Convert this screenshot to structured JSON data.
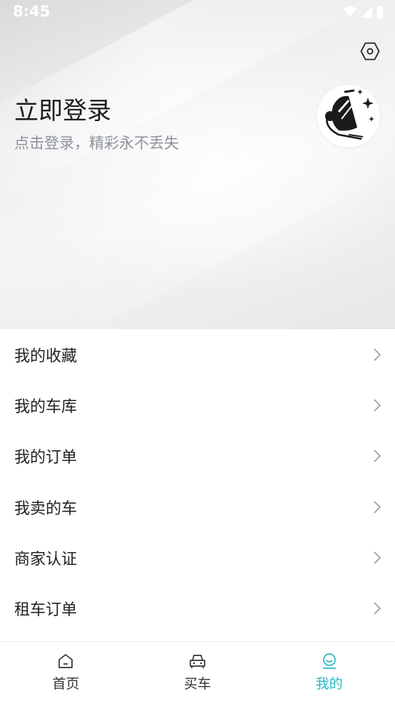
{
  "status_bar": {
    "time": "8:45"
  },
  "colors": {
    "accent": "#2bb8c4",
    "text": "#222222",
    "subtext": "#8e9299"
  },
  "header": {
    "settings_icon": "settings-hexagon-icon",
    "login_title": "立即登录",
    "login_subtitle": "点击登录，精彩永不丢失",
    "avatar_icon": "default-avatar-icon"
  },
  "menu": {
    "items": [
      {
        "label": "我的收藏"
      },
      {
        "label": "我的车库"
      },
      {
        "label": "我的订单"
      },
      {
        "label": "我卖的车"
      },
      {
        "label": "商家认证"
      },
      {
        "label": "租车订单"
      }
    ]
  },
  "tabbar": {
    "tabs": [
      {
        "label": "首页",
        "icon": "home-icon",
        "active": false
      },
      {
        "label": "买车",
        "icon": "car-icon",
        "active": false
      },
      {
        "label": "我的",
        "icon": "profile-icon",
        "active": true
      }
    ]
  }
}
